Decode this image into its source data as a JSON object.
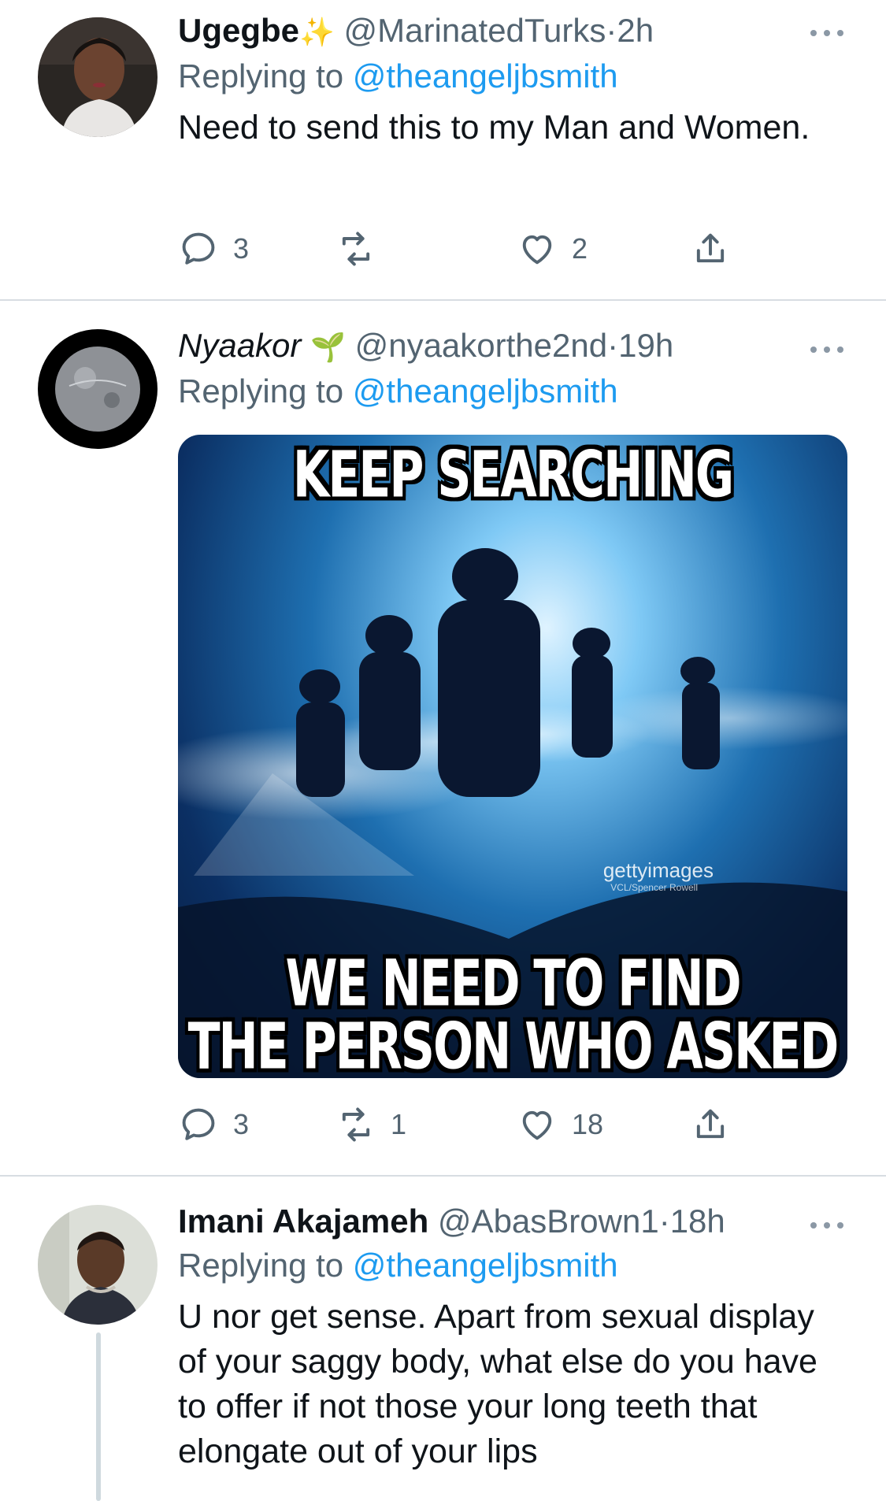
{
  "tweets": [
    {
      "name": "Ugegbe",
      "name_emoji": "✨",
      "handle": "@MarinatedTurks",
      "time": "2h",
      "replying_prefix": "Replying to",
      "replying_to": "@theangeljbsmith",
      "text": "Need to send this to my Man and Women.",
      "replies": "3",
      "retweets": "",
      "likes": "2"
    },
    {
      "name": "Nyaakor",
      "name_emoji": "🌱",
      "handle": "@nyaakorthe2nd",
      "time": "19h",
      "replying_prefix": "Replying to",
      "replying_to": "@theangeljbsmith",
      "media": {
        "top_text": "KEEP SEARCHING",
        "bottom_text_line1": "WE NEED TO FIND",
        "bottom_text_line2": "THE PERSON WHO ASKED",
        "watermark": "gettyimages",
        "watermark_sub": "VCL/Spencer Rowell"
      },
      "replies": "3",
      "retweets": "1",
      "likes": "18"
    },
    {
      "name": "Imani Akajameh",
      "handle": "@AbasBrown1",
      "time": "18h",
      "replying_prefix": "Replying to",
      "replying_to": "@theangeljbsmith",
      "text": "U nor get sense. Apart from sexual display of your saggy body, what else do you have to offer if not those your long teeth that elongate out of your lips"
    }
  ],
  "separator": "·",
  "colors": {
    "link": "#1d9bf0",
    "secondary": "#536471",
    "divider": "#d8dde2"
  }
}
